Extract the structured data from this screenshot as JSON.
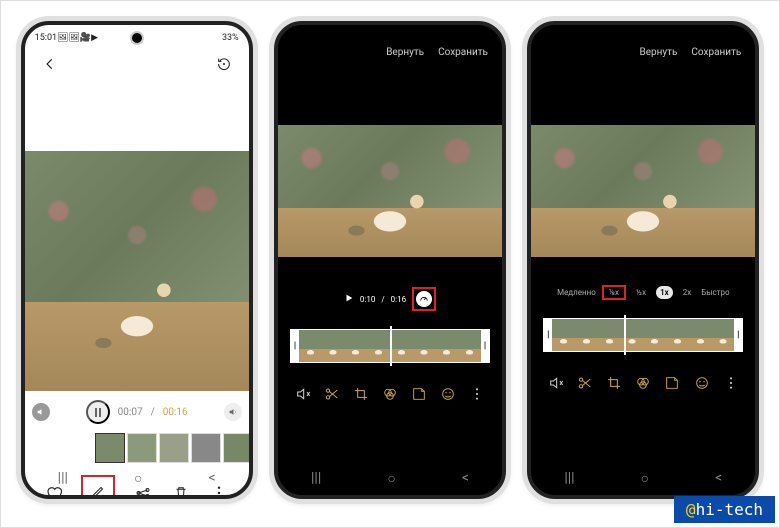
{
  "watermark": "hi-tech",
  "phone1": {
    "time": "15:01",
    "status_icons": "🖼🖼🎥▶",
    "battery_pct": "33%",
    "playback": {
      "current": "00:07",
      "total": "00:16"
    },
    "tools": {
      "favorite": "♡",
      "edit": "✎",
      "share": "<",
      "delete": "🗑",
      "more": "⋮"
    }
  },
  "phone2": {
    "top": {
      "revert": "Вернуть",
      "save": "Сохранить"
    },
    "playback": {
      "current": "0:10",
      "total": "0:16"
    }
  },
  "phone3": {
    "top": {
      "revert": "Вернуть",
      "save": "Сохранить"
    },
    "speed": {
      "slow_label": "Медленно",
      "fast_label": "Быстро",
      "options": [
        "⅛x",
        "½x",
        "1x",
        "2x"
      ],
      "selected": "1x"
    }
  },
  "editor_tools": {
    "audio": "🔇",
    "cut": "✂",
    "crop": "⛶",
    "filter": "⟳",
    "sticker": "◐",
    "emoji": "☺",
    "more": "⋮"
  },
  "nav": {
    "recent": "|||",
    "home": "○",
    "back": "<"
  }
}
